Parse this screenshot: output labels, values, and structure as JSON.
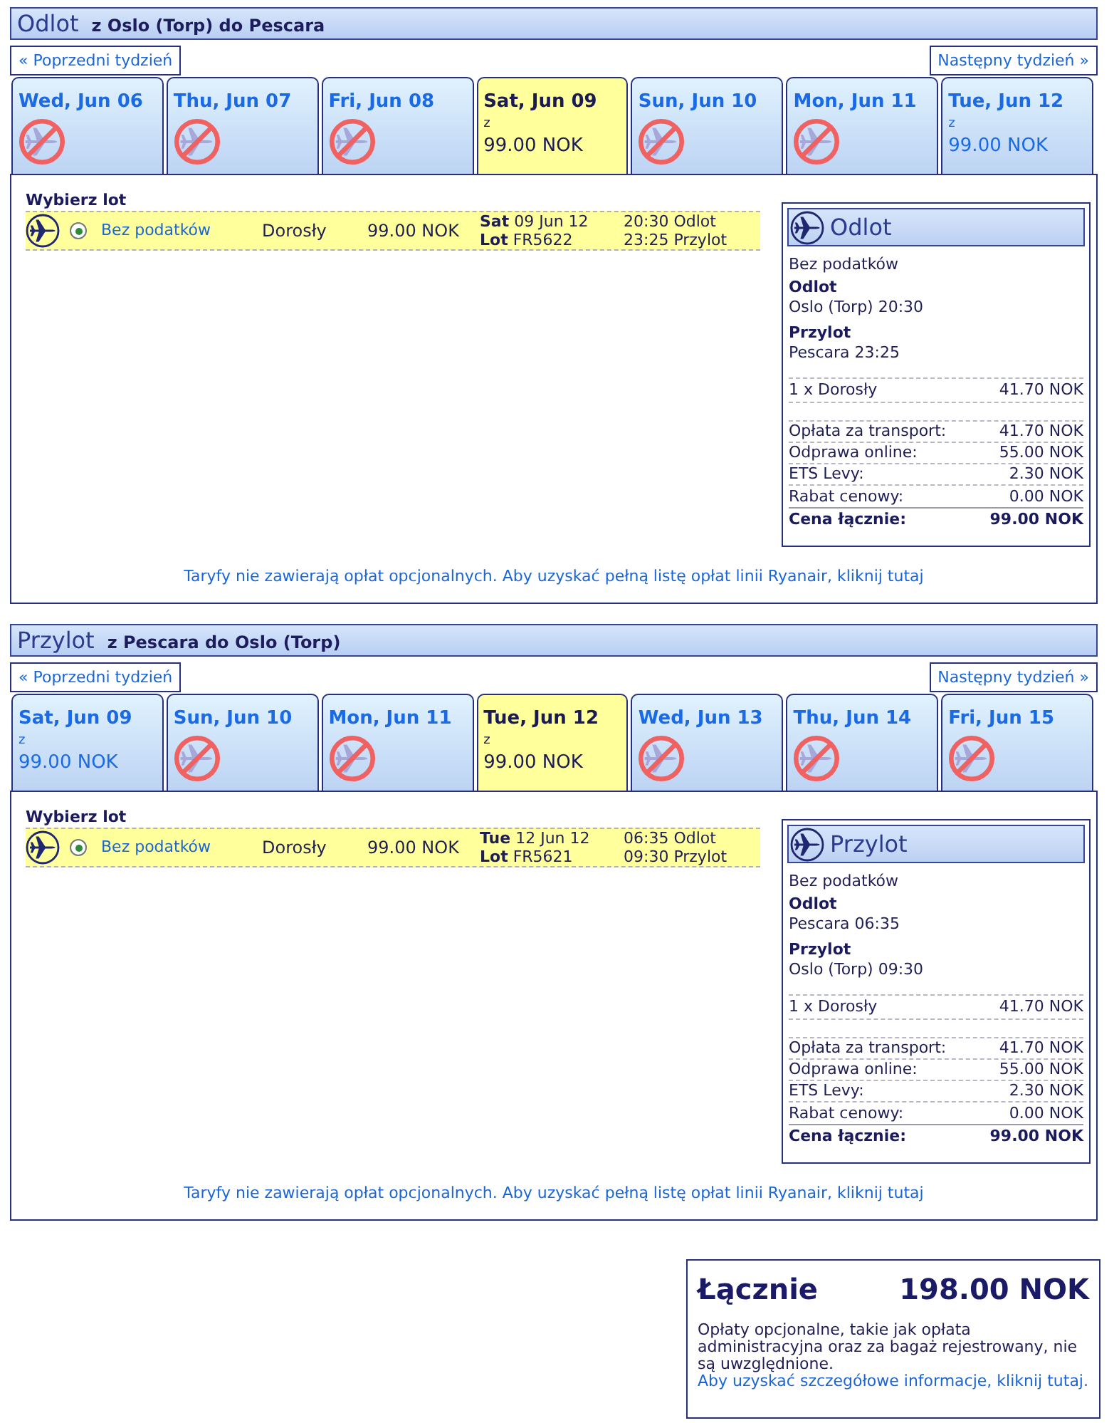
{
  "sections": [
    {
      "title": "Odlot",
      "route": "z Oslo (Torp) do Pescara",
      "prev_week": "« Poprzedni tydzień",
      "next_week": "Następny tydzień »",
      "days": [
        {
          "date": "Wed, Jun 06",
          "available": false,
          "selected": false
        },
        {
          "date": "Thu, Jun 07",
          "available": false,
          "selected": false
        },
        {
          "date": "Fri, Jun 08",
          "available": false,
          "selected": false
        },
        {
          "date": "Sat, Jun 09",
          "available": true,
          "from": "z",
          "price": "99.00 NOK",
          "selected": true
        },
        {
          "date": "Sun, Jun 10",
          "available": false,
          "selected": false
        },
        {
          "date": "Mon, Jun 11",
          "available": false,
          "selected": false
        },
        {
          "date": "Tue, Jun 12",
          "available": true,
          "from": "z",
          "price": "99.00 NOK",
          "selected": false
        }
      ],
      "select_label": "Wybierz lot",
      "flights": [
        {
          "selected": true,
          "fare": "Bez podatków",
          "passenger": "Dorosły",
          "price": "99.00 NOK",
          "date_line": "**Sat** 09 Jun 12",
          "flight_line": "**Lot** FR5622",
          "departure": "20:30 Odlot",
          "arrival": "23:25 Przylot"
        }
      ],
      "summary": {
        "title": "Odlot",
        "fare": "Bez podatków",
        "legs": [
          {
            "label": "Odlot",
            "value": "Oslo (Torp) 20:30"
          },
          {
            "label": "Przylot",
            "value": "Pescara 23:25"
          }
        ],
        "passenger": {
          "label": "1 x Dorosły",
          "value": "41.70 NOK"
        },
        "fees": [
          {
            "label": "Opłata za transport:",
            "value": "41.70 NOK"
          },
          {
            "label": "Odprawa online:",
            "value": "55.00 NOK"
          },
          {
            "label": "ETS Levy:",
            "value": "2.30 NOK"
          },
          {
            "label": "Rabat cenowy:",
            "value": "0.00 NOK"
          }
        ],
        "total": {
          "label": "Cena łącznie:",
          "value": "99.00 NOK"
        }
      },
      "note": "Taryfy nie zawierają opłat opcjonalnych. Aby uzyskać pełną listę opłat linii Ryanair, kliknij tutaj"
    },
    {
      "title": "Przylot",
      "route": "z Pescara do Oslo (Torp)",
      "prev_week": "« Poprzedni tydzień",
      "next_week": "Następny tydzień »",
      "days": [
        {
          "date": "Sat, Jun 09",
          "available": true,
          "from": "z",
          "price": "99.00 NOK",
          "selected": false
        },
        {
          "date": "Sun, Jun 10",
          "available": false,
          "selected": false
        },
        {
          "date": "Mon, Jun 11",
          "available": false,
          "selected": false
        },
        {
          "date": "Tue, Jun 12",
          "available": true,
          "from": "z",
          "price": "99.00 NOK",
          "selected": true
        },
        {
          "date": "Wed, Jun 13",
          "available": false,
          "selected": false
        },
        {
          "date": "Thu, Jun 14",
          "available": false,
          "selected": false
        },
        {
          "date": "Fri, Jun 15",
          "available": false,
          "selected": false
        }
      ],
      "select_label": "Wybierz lot",
      "flights": [
        {
          "selected": true,
          "fare": "Bez podatków",
          "passenger": "Dorosły",
          "price": "99.00 NOK",
          "date_line": "**Tue** 12 Jun 12",
          "flight_line": "**Lot** FR5621",
          "departure": "06:35 Odlot",
          "arrival": "09:30 Przylot"
        }
      ],
      "summary": {
        "title": "Przylot",
        "fare": "Bez podatków",
        "legs": [
          {
            "label": "Odlot",
            "value": "Pescara 06:35"
          },
          {
            "label": "Przylot",
            "value": "Oslo (Torp) 09:30"
          }
        ],
        "passenger": {
          "label": "1 x Dorosły",
          "value": "41.70 NOK"
        },
        "fees": [
          {
            "label": "Opłata za transport:",
            "value": "41.70 NOK"
          },
          {
            "label": "Odprawa online:",
            "value": "55.00 NOK"
          },
          {
            "label": "ETS Levy:",
            "value": "2.30 NOK"
          },
          {
            "label": "Rabat cenowy:",
            "value": "0.00 NOK"
          }
        ],
        "total": {
          "label": "Cena łącznie:",
          "value": "99.00 NOK"
        }
      },
      "note": "Taryfy nie zawierają opłat opcjonalnych. Aby uzyskać pełną listę opłat linii Ryanair, kliknij tutaj"
    }
  ],
  "total": {
    "label": "Łącznie",
    "amount": "198.00 NOK",
    "note": "Opłaty opcjonalne, takie jak opłata administracyjna oraz za bagaż rejestrowany, nie są uwzględnione.",
    "link": "Aby uzyskać szczegółowe informacje, kliknij tutaj."
  }
}
